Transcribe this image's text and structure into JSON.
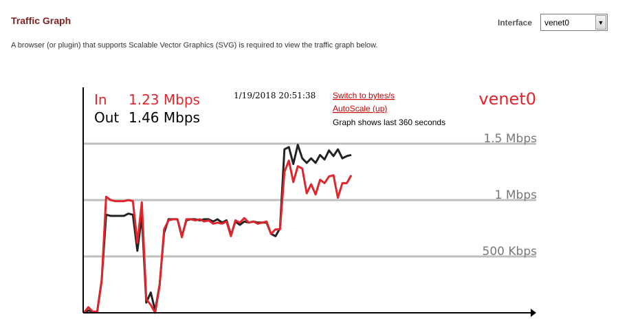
{
  "page": {
    "title": "Traffic Graph",
    "interface_label": "Interface",
    "interface_value": "venet0",
    "notice": "A browser (or plugin) that supports Scalable Vector Graphics (SVG) is required to view the traffic graph below."
  },
  "graph": {
    "in_label": "In",
    "in_value": "1.23 Mbps",
    "out_label": "Out",
    "out_value": "1.46 Mbps",
    "timestamp": "1/19/2018 20:51:38",
    "switch_link": "Switch to bytes/s",
    "autoscale_link": "AutoScale (up)",
    "window_text": "Graph shows last 360 seconds",
    "interface_name": "venet0",
    "colors": {
      "in": "#e0252c",
      "out": "#222222",
      "grid": "#bfbfbf",
      "link": "#cc0000"
    }
  },
  "chart_data": {
    "type": "line",
    "title": "",
    "xlabel": "",
    "ylabel": "",
    "ylim": [
      0,
      1.5
    ],
    "yticks": [
      {
        "value": 1.5,
        "label": "1.5 Mbps"
      },
      {
        "value": 1.0,
        "label": "1 Mbps"
      },
      {
        "value": 0.5,
        "label": "500 Kbps"
      }
    ],
    "grid": true,
    "x_seconds": [
      0,
      6,
      12,
      18,
      24,
      30,
      36,
      42,
      48,
      54,
      60,
      66,
      72,
      78,
      84,
      90,
      96,
      102,
      108,
      114,
      120,
      126,
      132,
      138,
      144,
      150,
      156,
      162,
      168,
      174,
      180,
      186,
      192,
      198,
      204,
      210,
      216,
      222,
      228,
      234,
      240,
      246,
      252,
      258,
      264,
      270,
      276,
      282,
      288,
      294,
      300,
      306,
      312,
      318,
      324,
      330,
      336,
      342,
      348,
      354,
      360
    ],
    "series": [
      {
        "name": "In",
        "values": [
          0.0,
          0.05,
          0.01,
          0.01,
          0.28,
          1.03,
          1.0,
          0.99,
          0.99,
          0.99,
          1.0,
          0.99,
          0.62,
          0.98,
          0.12,
          0.07,
          0.0,
          0.24,
          0.74,
          0.82,
          0.83,
          0.83,
          0.67,
          0.83,
          0.83,
          0.82,
          0.83,
          0.81,
          0.82,
          0.79,
          0.8,
          0.79,
          0.81,
          0.68,
          0.82,
          0.8,
          0.84,
          0.8,
          0.81,
          0.79,
          0.8,
          0.81,
          0.7,
          0.74,
          0.74,
          1.25,
          1.35,
          1.16,
          1.3,
          1.28,
          1.06,
          1.14,
          1.05,
          1.18,
          1.15,
          1.21,
          1.22,
          1.02,
          1.15,
          1.15,
          1.22
        ]
      },
      {
        "name": "Out",
        "values": [
          0.0,
          0.02,
          0.01,
          0.01,
          0.29,
          0.87,
          0.86,
          0.86,
          0.86,
          0.86,
          0.88,
          0.87,
          0.55,
          0.86,
          0.09,
          0.18,
          0.02,
          0.25,
          0.71,
          0.83,
          0.83,
          0.83,
          0.68,
          0.82,
          0.83,
          0.83,
          0.82,
          0.83,
          0.83,
          0.81,
          0.83,
          0.8,
          0.82,
          0.69,
          0.81,
          0.78,
          0.81,
          0.8,
          0.81,
          0.8,
          0.8,
          0.8,
          0.7,
          0.68,
          0.75,
          1.45,
          1.47,
          1.32,
          1.49,
          1.37,
          1.33,
          1.37,
          1.33,
          1.4,
          1.36,
          1.44,
          1.39,
          1.45,
          1.37,
          1.39,
          1.4
        ]
      }
    ]
  }
}
